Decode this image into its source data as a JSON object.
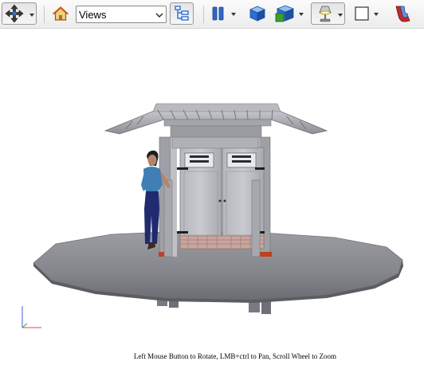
{
  "toolbar": {
    "views_select": {
      "value": "Views"
    },
    "buttons": [
      "navigate-mode",
      "home",
      "views",
      "tree-view",
      "pause",
      "solid-box",
      "cube-color",
      "light-bulb",
      "background-box",
      "magnet"
    ]
  },
  "icons": {
    "navigate": "four-arrows-icon",
    "home": "home-icon",
    "tree": "tree-view-icon",
    "pause": "pause-icon",
    "box": "cube-icon",
    "color_cube": "color-cube-icon",
    "light": "desk-lamp-icon",
    "background": "square-outline-icon",
    "magnet": "magnet-icon"
  },
  "status": {
    "hint": "Left Mouse Button to Rotate, LMB+ctrl to Pan, Scroll Wheel to Zoom"
  },
  "colors": {
    "accent_blue": "#2e6fd0",
    "pause_blue": "#2f67c9",
    "cube_green": "#3aa12d",
    "magnet_red": "#c02a2a"
  }
}
